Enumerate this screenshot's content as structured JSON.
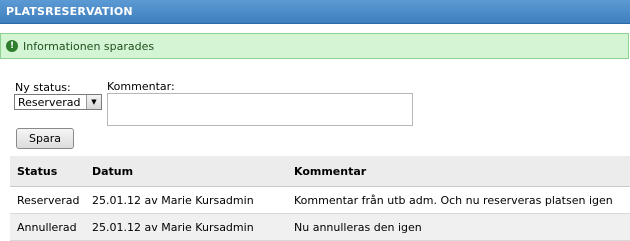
{
  "header": {
    "title": "PLATSRESERVATION"
  },
  "notice": {
    "icon": "info-icon",
    "text": "Informationen sparades"
  },
  "form": {
    "status_label": "Ny status:",
    "status_value": "Reserverad",
    "comment_label": "Kommentar:",
    "comment_value": "",
    "save_label": "Spara"
  },
  "history": {
    "columns": [
      "Status",
      "Datum",
      "Kommentar"
    ],
    "rows": [
      [
        "Reserverad",
        "25.01.12 av Marie Kursadmin",
        "Kommentar från utb adm. Och nu reserveras platsen igen"
      ],
      [
        "Annullerad",
        "25.01.12 av Marie Kursadmin",
        "Nu annulleras den igen"
      ]
    ]
  },
  "colors": {
    "header_bg": "#4a8ac7",
    "notice_bg": "#d4f5d4",
    "notice_border": "#8fd18f"
  }
}
